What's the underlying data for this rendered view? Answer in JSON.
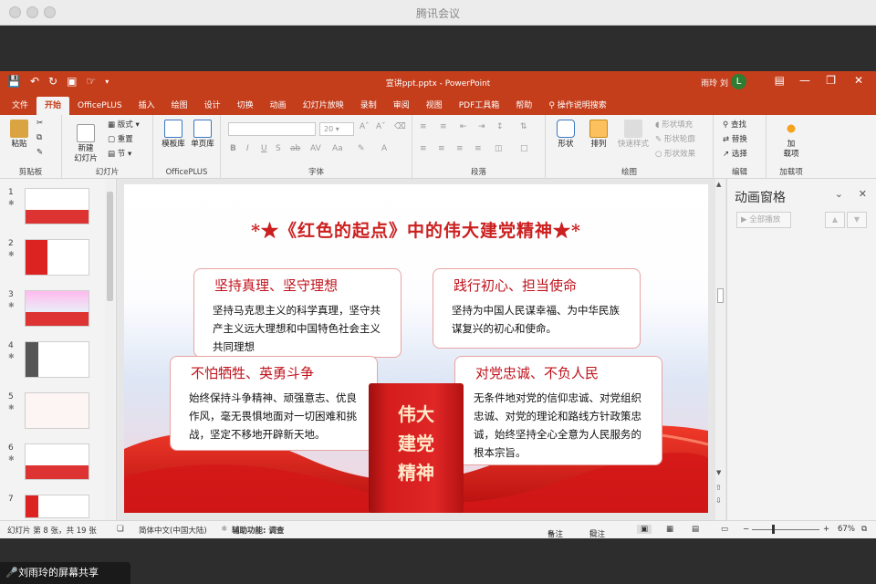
{
  "window": {
    "title": "腾讯会议"
  },
  "ppt": {
    "filename": "宣讲ppt.pptx - PowerPoint",
    "user": "雨玲 刘",
    "avatar_letter": "L",
    "tabs": [
      "文件",
      "开始",
      "OfficePLUS",
      "插入",
      "绘图",
      "设计",
      "切换",
      "动画",
      "幻灯片放映",
      "录制",
      "审阅",
      "视图",
      "PDF工具箱",
      "帮助"
    ],
    "active_tab": "开始",
    "tell_me": "操作说明搜索"
  },
  "ribbon": {
    "clipboard": {
      "paste": "粘贴",
      "label": "剪贴板"
    },
    "slides": {
      "new_slide": "新建\n幻灯片",
      "layout": "版式",
      "reset": "重置",
      "section": "节",
      "label": "幻灯片"
    },
    "officeplus": {
      "template_lib": "模板库",
      "single_page_lib": "单页库",
      "label": "OfficePLUS"
    },
    "font": {
      "size": "20",
      "label": "字体"
    },
    "paragraph": {
      "label": "段落"
    },
    "drawing": {
      "shapes": "形状",
      "arrange": "排列",
      "quick_styles": "快速样式",
      "fill": "形状填充",
      "outline": "形状轮廓",
      "effects": "形状效果",
      "label": "绘图"
    },
    "editing": {
      "find": "查找",
      "replace": "替换",
      "select": "选择",
      "label": "编辑"
    },
    "addins": {
      "addin": "加\n载项",
      "label": "加载项"
    }
  },
  "thumbnails": [
    "1",
    "2",
    "3",
    "4",
    "5",
    "6",
    "7"
  ],
  "slide": {
    "title": "*★《红色的起点》中的伟大建党精神★*",
    "cards": [
      {
        "heading": "坚持真理、坚守理想",
        "body": "坚持马克思主义的科学真理，坚守共产主义远大理想和中国特色社会主义共同理想"
      },
      {
        "heading": "践行初心、担当使命",
        "body": "坚持为中国人民谋幸福、为中华民族谋复兴的初心和使命。"
      },
      {
        "heading": "不怕牺牲、英勇斗争",
        "body": "始终保持斗争精神、顽强意志、优良作风，毫无畏惧地面对一切困难和挑战，坚定不移地开辟新天地。"
      },
      {
        "heading": "对党忠诚、不负人民",
        "body": "无条件地对党的信仰忠诚、对党组织忠诚、对党的理论和路线方针政策忠诚，始终坚持全心全意为人民服务的根本宗旨。"
      }
    ],
    "book_text": "伟大\n建党\n精神"
  },
  "animation_pane": {
    "title": "动画窗格",
    "play_all": "全部播放"
  },
  "status": {
    "slide_info": "幻灯片 第 8 张，共 19 张",
    "language": "简体中文(中国大陆)",
    "accessibility": "辅助功能: 调查",
    "notes": "备注",
    "comments": "批注",
    "zoom": "67%"
  },
  "share_badge": "刘雨玲的屏幕共享"
}
